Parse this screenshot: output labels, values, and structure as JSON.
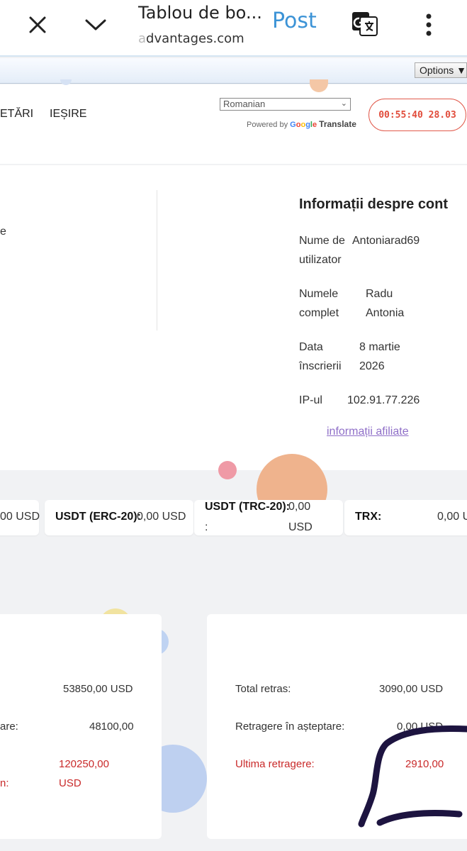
{
  "browser": {
    "tab_title": "Tablou de bo...",
    "url_faded": "a",
    "url": "dvantages.com",
    "post_label": "Post",
    "icons": {
      "close": "close-icon",
      "collapse": "chevron-down-icon",
      "translate": "google-translate-icon",
      "more": "more-vertical-icon"
    }
  },
  "translate_bar": {
    "options_label": "Options ▼"
  },
  "header": {
    "nav": [
      "ETĂRI",
      "IEȘIRE"
    ],
    "language": "Romanian",
    "powered_by": "Powered by",
    "powered_google": "Google",
    "powered_translate": "Translate",
    "timer": "00:55:40 28.03"
  },
  "account": {
    "left_fragment": "e",
    "title": "Informații despre cont",
    "rows": [
      {
        "label1": "Nume de",
        "label2": "utilizator",
        "value1": "Antoniarad69",
        "value2": ""
      },
      {
        "label1": "Numele",
        "label2": "complet",
        "value1": "Radu",
        "value2": "Antonia"
      },
      {
        "label1": "Data",
        "label2": "înscrierii",
        "value1": "8 martie",
        "value2": "2026"
      },
      {
        "label1": "IP-ul",
        "label2": "",
        "value1": "102.91.77.226",
        "value2": ""
      }
    ],
    "affiliate_link": "informații afiliate"
  },
  "balances": [
    {
      "label": "",
      "value": "00 USD"
    },
    {
      "label": "USDT (ERC-20):",
      "value": "0,00 USD"
    },
    {
      "label": "USDT (TRC-20):",
      "label_suffix": ":",
      "value1": "0,00",
      "value2": "USD"
    },
    {
      "label": "TRX:",
      "value": "0,00 U"
    }
  ],
  "deposits_card": {
    "row1_value": "53850,00 USD",
    "row2_label": "are:",
    "row2_value": "48100,00",
    "row3_label": "n:",
    "row3_value1": "120250,00",
    "row3_value2": "USD"
  },
  "withdrawals_card": {
    "total_label": "Total retras:",
    "total_value": "3090,00 USD",
    "pending_label": "Retragere în așteptare:",
    "pending_value": "0,00 USD",
    "last_label": "Ultima retragere:",
    "last_value": "2910,00"
  },
  "colors": {
    "accent_blue": "#3c93d6",
    "timer_red": "#e14c3b",
    "link_purple": "#8f6fc8",
    "negative_red": "#c92a2a",
    "scribble": "#1d1440"
  }
}
